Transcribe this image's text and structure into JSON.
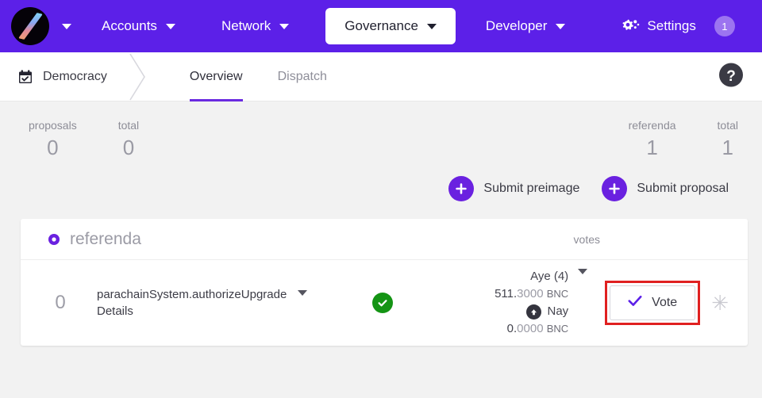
{
  "topnav": {
    "logo_icon": "bifrost-logo-icon",
    "logo_caret_icon": "chevron-down-icon",
    "items": [
      {
        "label": "Accounts",
        "icon": "chevron-down-icon"
      },
      {
        "label": "Network",
        "icon": "chevron-down-icon"
      },
      {
        "label": "Governance",
        "icon": "chevron-down-icon"
      },
      {
        "label": "Developer",
        "icon": "chevron-down-icon"
      }
    ],
    "settings": {
      "label": "Settings",
      "icon": "gear-icon",
      "badge": "1"
    },
    "active_item": "Governance",
    "background_color": "#5c20e8"
  },
  "subnav": {
    "breadcrumb": {
      "label": "Democracy",
      "icon": "calendar-check-icon"
    },
    "separator_icon": "chevron-right-separator-icon",
    "tabs": [
      {
        "label": "Overview",
        "active": true
      },
      {
        "label": "Dispatch",
        "active": false
      }
    ],
    "help_icon": "help-circle-icon",
    "active_underline_color": "#6a2ae0"
  },
  "stats": {
    "left": [
      {
        "label": "proposals",
        "value": "0"
      },
      {
        "label": "total",
        "value": "0"
      }
    ],
    "right": [
      {
        "label": "referenda",
        "value": "1"
      },
      {
        "label": "total",
        "value": "1"
      }
    ]
  },
  "actions": {
    "preimage": {
      "label": "Submit preimage",
      "icon": "plus-circle-icon"
    },
    "proposal": {
      "label": "Submit proposal",
      "icon": "plus-circle-icon"
    },
    "accent_color": "#6a21e0"
  },
  "card": {
    "title": "referenda",
    "title_icon": "referenda-dot-icon",
    "votes_column_header": "votes",
    "row": {
      "index": "0",
      "name": "parachainSystem.authorizeUpgrade",
      "details_label": "Details",
      "expand_icon": "chevron-down-icon",
      "status_icon": "check-circle-icon",
      "status_color": "#149414",
      "aye_label": "Aye (4)",
      "aye_amount_int": "511.",
      "aye_amount_frac": "3000",
      "aye_unit": "BNC",
      "nay_label": "Nay",
      "nay_icon": "arrow-up-circle-icon",
      "nay_amount_int": "0.",
      "nay_amount_frac": "0000",
      "nay_unit": "BNC",
      "votes_expand_icon": "chevron-down-icon",
      "vote_button_label": "Vote",
      "vote_button_icon": "check-icon",
      "extra_icon": "asterisk-icon",
      "extra_icon_glyph": "✳",
      "highlight_color": "#e02020"
    }
  }
}
